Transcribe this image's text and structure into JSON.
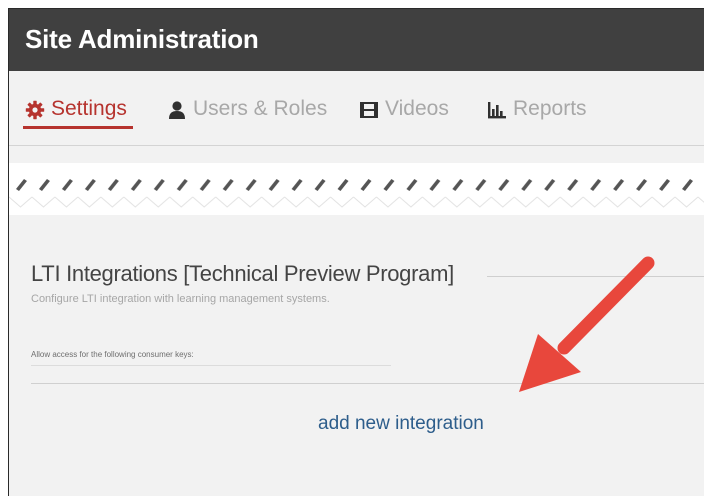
{
  "header": {
    "title": "Site Administration"
  },
  "tabs": [
    {
      "label": "Settings",
      "icon": "gear-icon",
      "active": true
    },
    {
      "label": "Users & Roles",
      "icon": "user-icon",
      "active": false
    },
    {
      "label": "Videos",
      "icon": "film-icon",
      "active": false
    },
    {
      "label": "Reports",
      "icon": "bar-chart-icon",
      "active": false
    }
  ],
  "lti": {
    "title": "LTI Integrations [Technical Preview Program]",
    "description": "Configure LTI integration with learning management systems.",
    "consumer_keys_label": "Allow access for the following consumer keys:",
    "add_link": "add new integration"
  },
  "colors": {
    "header_bg": "#404040",
    "accent": "#b6332e",
    "link": "#2d5d8b",
    "annotation_arrow": "#e8473c"
  }
}
